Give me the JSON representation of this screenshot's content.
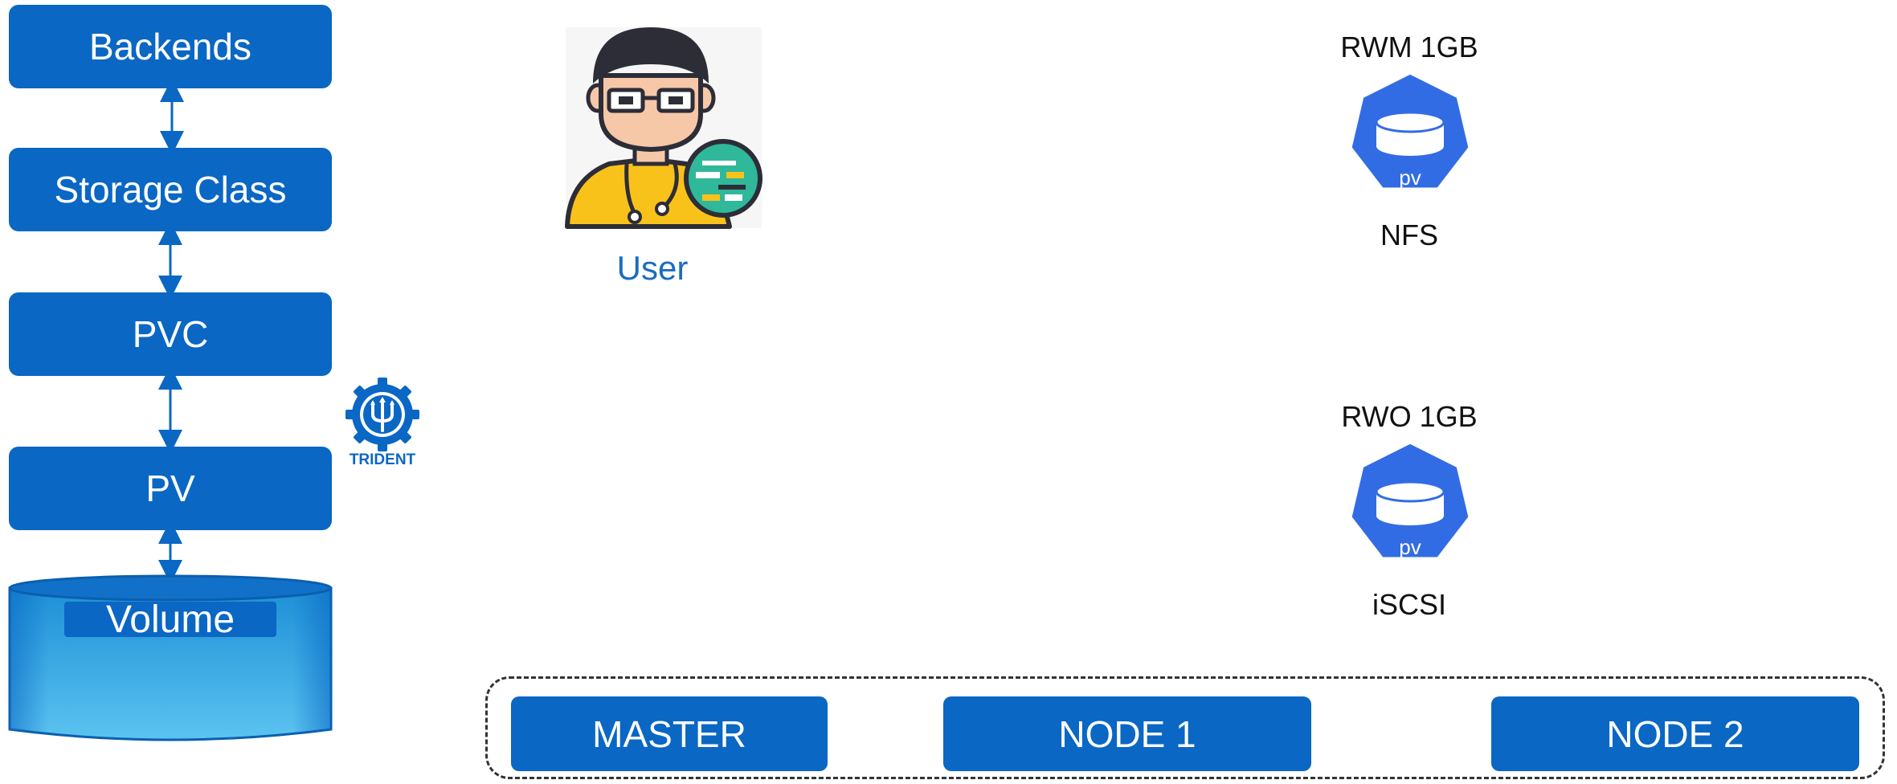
{
  "stack": {
    "backends": "Backends",
    "storage_class": "Storage Class",
    "pvc": "PVC",
    "pv": "PV",
    "volume": "Volume"
  },
  "trident": {
    "label": "TRIDENT",
    "icon": "trident-logo-icon"
  },
  "user": {
    "label": "User",
    "icon": "user-developer-icon"
  },
  "volumes": [
    {
      "access": "RWM 1GB",
      "badge": "pv",
      "protocol": "NFS"
    },
    {
      "access": "RWO 1GB",
      "badge": "pv",
      "protocol": "iSCSI"
    }
  ],
  "cluster": {
    "master": "MASTER",
    "node1": "NODE 1",
    "node2": "NODE 2"
  },
  "colors": {
    "box_blue": "#0a67c4",
    "pv_blue": "#326ce5",
    "volume_light": "#5bc3f0"
  }
}
